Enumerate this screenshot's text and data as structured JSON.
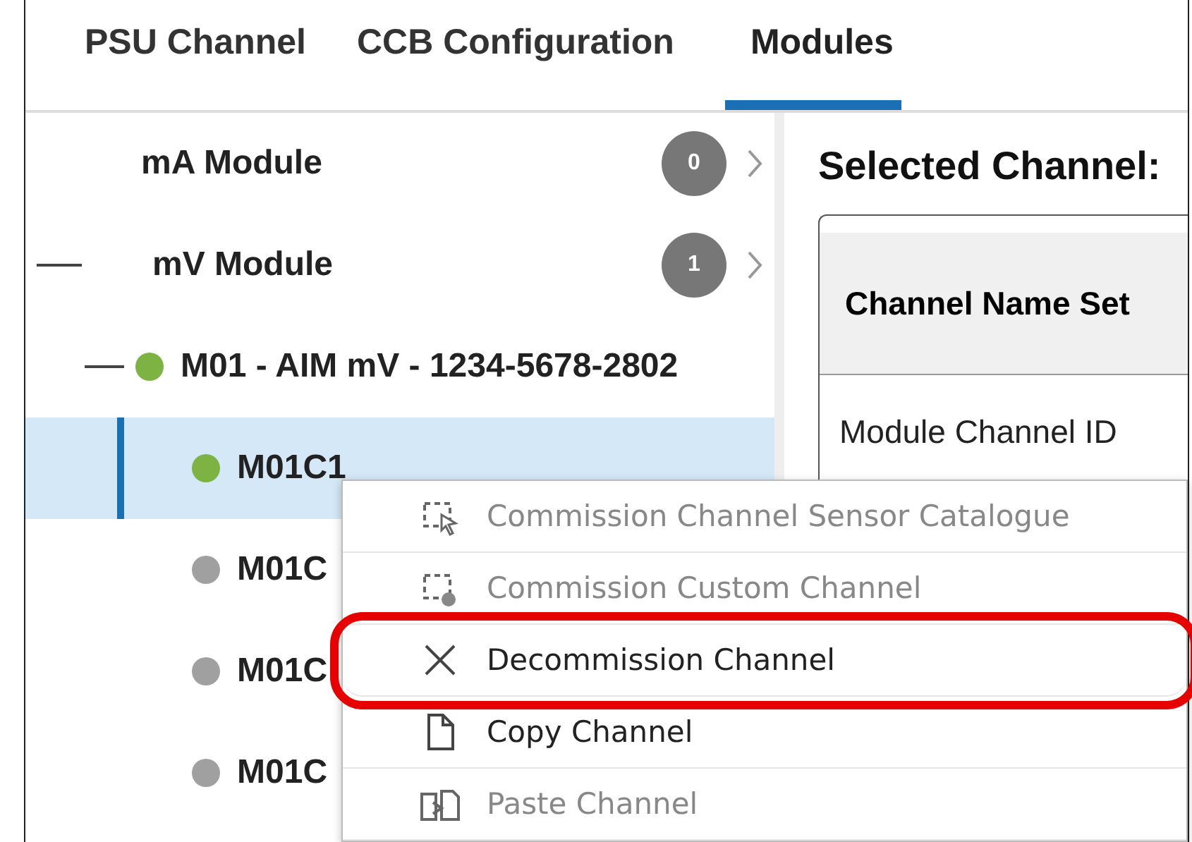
{
  "tabs": [
    {
      "label": "PSU Channel",
      "selected": false
    },
    {
      "label": "CCB Configuration",
      "selected": false
    },
    {
      "label": "Modules",
      "selected": true
    }
  ],
  "tree": [
    {
      "label": "mA Module",
      "count": "0",
      "expanded": false
    },
    {
      "label": "mV Module",
      "count": "1",
      "expanded": true,
      "children": [
        {
          "label": "M01 - AIM mV - 1234-5678-2802",
          "color": "#7cb342",
          "expanded": true,
          "children": [
            {
              "label": "M01C1",
              "color": "#7cb342",
              "selected": true
            },
            {
              "label": "M01C",
              "color": "#a0a0a0",
              "selected": false
            },
            {
              "label": "M01C",
              "color": "#a0a0a0",
              "selected": false
            },
            {
              "label": "M01C",
              "color": "#a0a0a0",
              "selected": false
            }
          ]
        }
      ]
    }
  ],
  "detail": {
    "title": "Selected Channel:",
    "header": "Channel Name Set",
    "row_label": "Module Channel ID"
  },
  "context_menu": [
    {
      "label": "Commission Channel Sensor Catalogue",
      "kind": "catalogue",
      "disabled": true,
      "highlighted": false
    },
    {
      "label": "Commission Custom Channel",
      "kind": "custom",
      "disabled": true,
      "highlighted": false
    },
    {
      "label": "Decommission Channel",
      "kind": "decommission",
      "disabled": false,
      "highlighted": true
    },
    {
      "label": "Copy Channel",
      "kind": "copy",
      "disabled": false,
      "highlighted": false
    },
    {
      "label": "Paste Channel",
      "kind": "paste",
      "disabled": true,
      "highlighted": false
    }
  ]
}
